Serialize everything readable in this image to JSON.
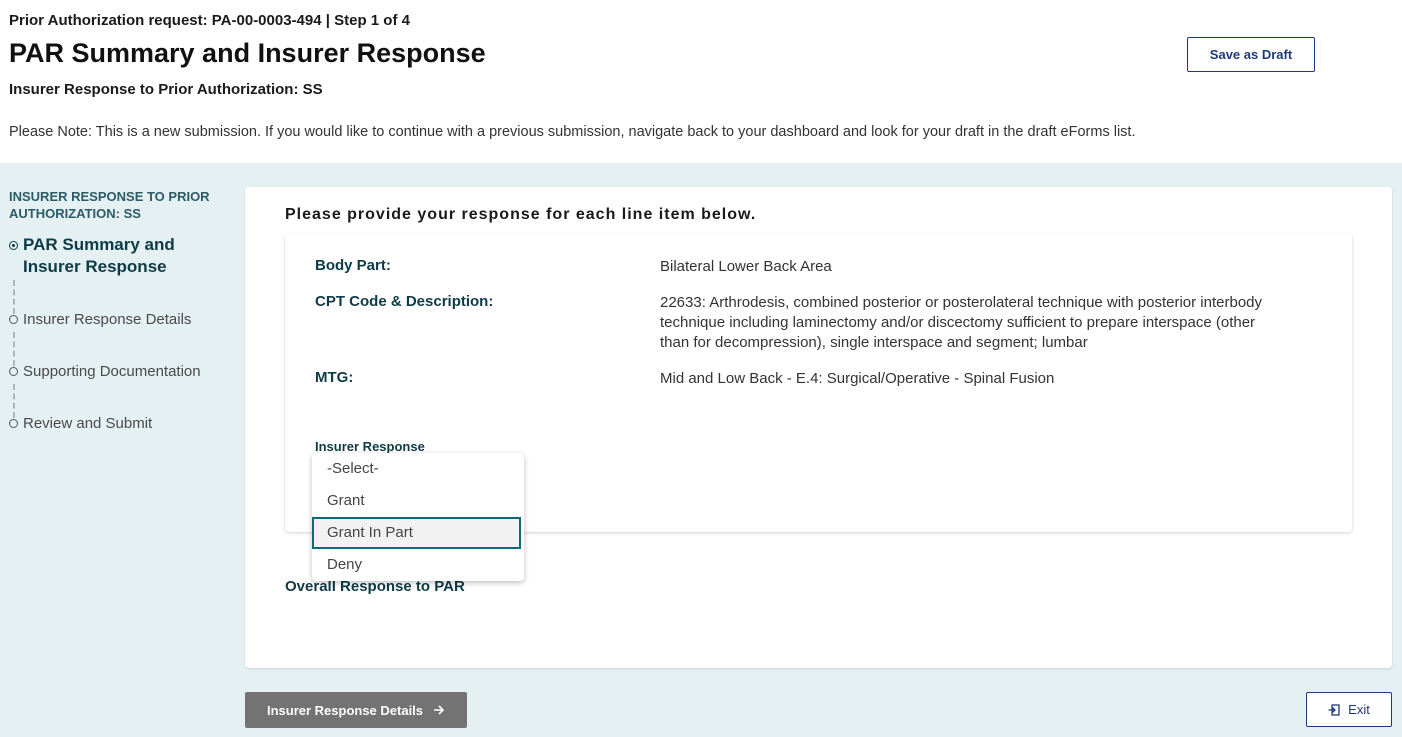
{
  "header": {
    "request_line": "Prior Authorization request: PA-00-0003-494 | Step 1 of 4",
    "title": "PAR Summary and Insurer Response",
    "subtitle": "Insurer Response to Prior Authorization: SS",
    "note": "Please Note: This is a new submission. If you would like to continue with a previous submission, navigate back to your dashboard and look for your draft in the draft eForms list.",
    "save_draft_label": "Save as Draft"
  },
  "sidebar": {
    "heading": "INSURER RESPONSE TO PRIOR AUTHORIZATION: SS",
    "steps": [
      {
        "label": "PAR Summary and Insurer Response",
        "active": true
      },
      {
        "label": "Insurer Response Details",
        "active": false
      },
      {
        "label": "Supporting Documentation",
        "active": false
      },
      {
        "label": "Review and Submit",
        "active": false
      }
    ]
  },
  "main": {
    "heading": "Please provide your response for each line item below.",
    "line_item": {
      "body_part_label": "Body Part:",
      "body_part_value": "Bilateral Lower Back Area",
      "cpt_label": "CPT Code & Description:",
      "cpt_value": "22633: Arthrodesis, combined posterior or posterolateral technique with posterior interbody technique including laminectomy and/or discectomy sufficient to prepare interspace (other than for decompression), single interspace and segment; lumbar",
      "mtg_label": "MTG:",
      "mtg_value": "Mid and Low Back - E.4: Surgical/Operative - Spinal Fusion",
      "insurer_response_label": "Insurer Response"
    },
    "insurer_response_dropdown": {
      "options": [
        "-Select-",
        "Grant",
        "Grant In Part",
        "Deny"
      ],
      "highlighted": "Grant In Part"
    },
    "overall_response_label": "Overall Response to PAR"
  },
  "footer": {
    "next_label": "Insurer Response Details",
    "exit_label": "Exit"
  },
  "colors": {
    "accent_dark_teal": "#0d3b47",
    "sidebar_heading": "#2c5b68",
    "background_panel": "#e4f0f2",
    "button_navy": "#1f3a7a",
    "disabled_button": "#737373",
    "focus_outline": "#0e6b73"
  }
}
